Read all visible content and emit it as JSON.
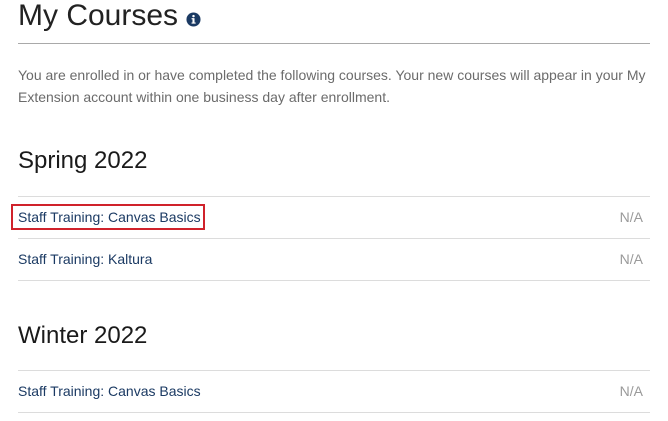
{
  "page": {
    "title": "My Courses",
    "info_icon": "info-circle-icon",
    "intro": "You are enrolled in or have completed the following courses. Your new courses will appear in your My Extension account within one business day after enrollment."
  },
  "terms": [
    {
      "name": "Spring 2022",
      "courses": [
        {
          "title": "Staff Training: Canvas Basics",
          "grade": "N/A"
        },
        {
          "title": "Staff Training: Kaltura",
          "grade": "N/A"
        }
      ]
    },
    {
      "name": "Winter 2022",
      "courses": [
        {
          "title": "Staff Training: Canvas Basics",
          "grade": "N/A"
        }
      ]
    }
  ],
  "colors": {
    "link": "#1b3a63",
    "highlight_outline": "#d0222b",
    "info_icon_bg": "#1b3a63"
  }
}
